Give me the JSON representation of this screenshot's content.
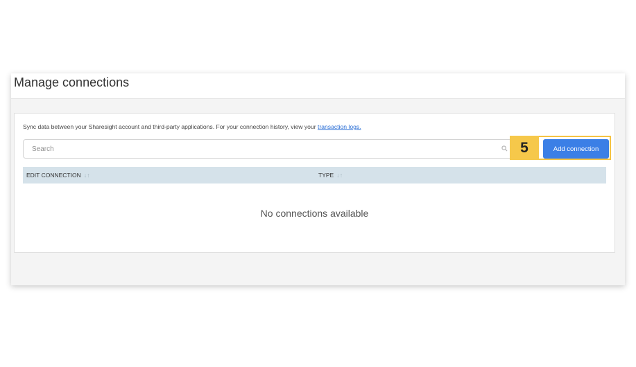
{
  "page": {
    "title": "Manage connections"
  },
  "intro": {
    "text": "Sync data between your Sharesight account and third-party applications. For your connection history, view your ",
    "link_text": "transaction logs."
  },
  "search": {
    "placeholder": "Search",
    "icon": "search-icon"
  },
  "step_badge": "5",
  "add_button": {
    "label": "Add connection"
  },
  "table": {
    "columns": [
      {
        "label": "EDIT CONNECTION",
        "sort_glyph": "↓↑"
      },
      {
        "label": "TYPE",
        "sort_glyph": "↓↑"
      }
    ],
    "empty_message": "No connections available"
  },
  "colors": {
    "accent": "#3b7fe6",
    "highlight": "#f6c84a",
    "table_header_bg": "#d5e2ea",
    "link": "#2b6fd6"
  }
}
